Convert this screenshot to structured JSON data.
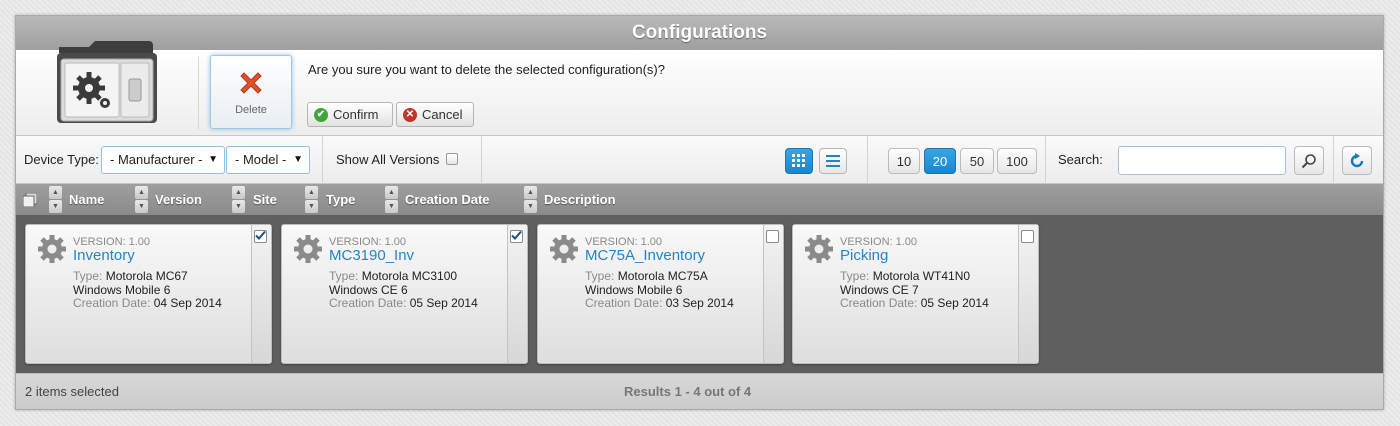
{
  "window": {
    "title": "Configurations"
  },
  "header": {
    "delete_label": "Delete",
    "confirm_message": "Are you sure you want to delete the selected configuration(s)?",
    "confirm_label": "Confirm",
    "cancel_label": "Cancel"
  },
  "toolbar": {
    "device_type_label": "Device Type:",
    "manufacturer_value": "- Manufacturer -",
    "model_value": "- Model -",
    "show_all_versions_label": "Show All Versions",
    "show_all_versions_checked": false,
    "view_mode": "grid",
    "page_sizes": [
      "10",
      "20",
      "50",
      "100"
    ],
    "page_size_selected": "20",
    "search_label": "Search:",
    "search_value": ""
  },
  "columns": {
    "name": "Name",
    "version": "Version",
    "site": "Site",
    "type": "Type",
    "creation_date": "Creation Date",
    "description": "Description"
  },
  "cards": [
    {
      "version_label": "VERSION: 1.00",
      "name": "Inventory",
      "type_key": "Type:",
      "type_value": "Motorola MC67",
      "os": "Windows Mobile 6",
      "date_key": "Creation Date:",
      "date_value": "04 Sep 2014",
      "checked": true
    },
    {
      "version_label": "VERSION: 1.00",
      "name": "MC3190_Inv",
      "type_key": "Type:",
      "type_value": "Motorola MC3100",
      "os": "Windows CE 6",
      "date_key": "Creation Date:",
      "date_value": "05 Sep 2014",
      "checked": true
    },
    {
      "version_label": "VERSION: 1.00",
      "name": "MC75A_Inventory",
      "type_key": "Type:",
      "type_value": "Motorola MC75A",
      "os": "Windows Mobile 6",
      "date_key": "Creation Date:",
      "date_value": "03 Sep 2014",
      "checked": false
    },
    {
      "version_label": "VERSION: 1.00",
      "name": "Picking",
      "type_key": "Type:",
      "type_value": "Motorola WT41N0",
      "os": "Windows CE 7",
      "date_key": "Creation Date:",
      "date_value": "05 Sep 2014",
      "checked": false
    }
  ],
  "footer": {
    "selected_text": "2 items selected",
    "results_text": "Results 1 - 4 out of 4"
  },
  "colors": {
    "accent": "#1a86cc",
    "link": "#2585c4",
    "delete_red": "#e0502a",
    "confirm_green": "#3da63a",
    "cancel_red": "#c0362c"
  }
}
